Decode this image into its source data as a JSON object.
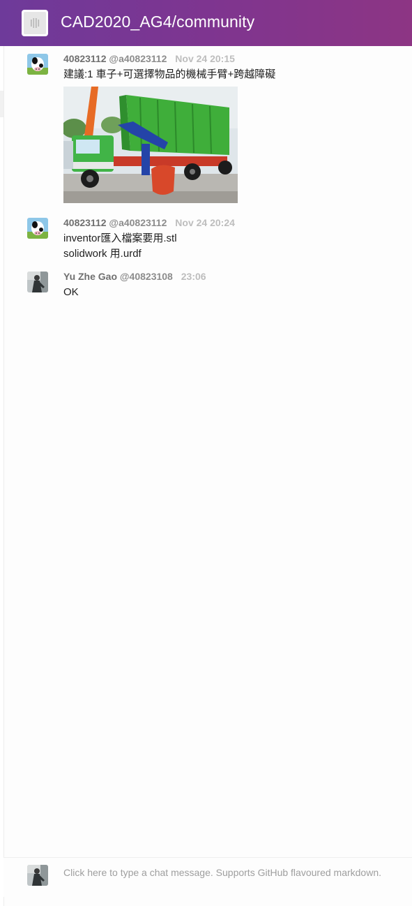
{
  "header": {
    "room_title": "CAD2020_AG4/community",
    "gradient_start": "#6e3a9a",
    "gradient_end": "#8d3584"
  },
  "messages": [
    {
      "name": "40823112",
      "username": "@a40823112",
      "time": "Nov 24 20:15",
      "lines": [
        "建議:1 車子+可選擇物品的機械手臂+跨越障礙"
      ],
      "avatar_icon": "cow-avatar",
      "attachment": "truck-with-crane-photo"
    },
    {
      "name": "40823112",
      "username": "@a40823112",
      "time": "Nov 24 20:24",
      "lines": [
        "inventor匯入檔案要用.stl",
        "solidwork 用.urdf"
      ],
      "avatar_icon": "cow-avatar"
    },
    {
      "name": "Yu Zhe Gao",
      "username": "@40823108",
      "time": "23:06",
      "lines": [
        "OK"
      ],
      "avatar_icon": "person-avatar"
    }
  ],
  "composer": {
    "placeholder": "Click here to type a chat message. Supports GitHub flavoured markdown.",
    "avatar_icon": "person-avatar"
  }
}
